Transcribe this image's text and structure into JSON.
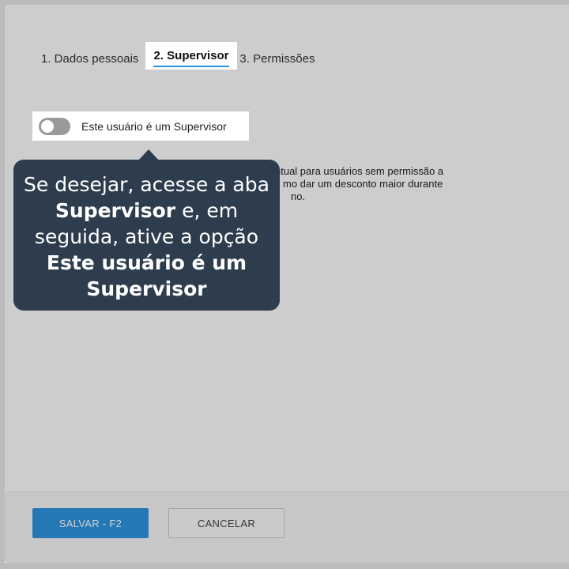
{
  "tabs": [
    {
      "label": "1. Dados pessoais"
    },
    {
      "label": "2. Supervisor"
    },
    {
      "label": "3. Permissões"
    }
  ],
  "toggle": {
    "label": "Este usuário é um Supervisor",
    "checked": false
  },
  "description": {
    "line1": "ntual para usuários sem permissão a",
    "line2": "mo dar um desconto maior durante",
    "line3": "no."
  },
  "tooltip": {
    "part1": "Se desejar, acesse a aba ",
    "bold1": "Supervisor",
    "part2": " e, em seguida, ative a opção ",
    "bold2": "Este usuário é um Supervisor"
  },
  "footer": {
    "save_label": "SALVAR - F2",
    "cancel_label": "CANCELAR"
  },
  "colors": {
    "accent": "#2d93de",
    "tooltip_bg": "#2e3d4e"
  }
}
